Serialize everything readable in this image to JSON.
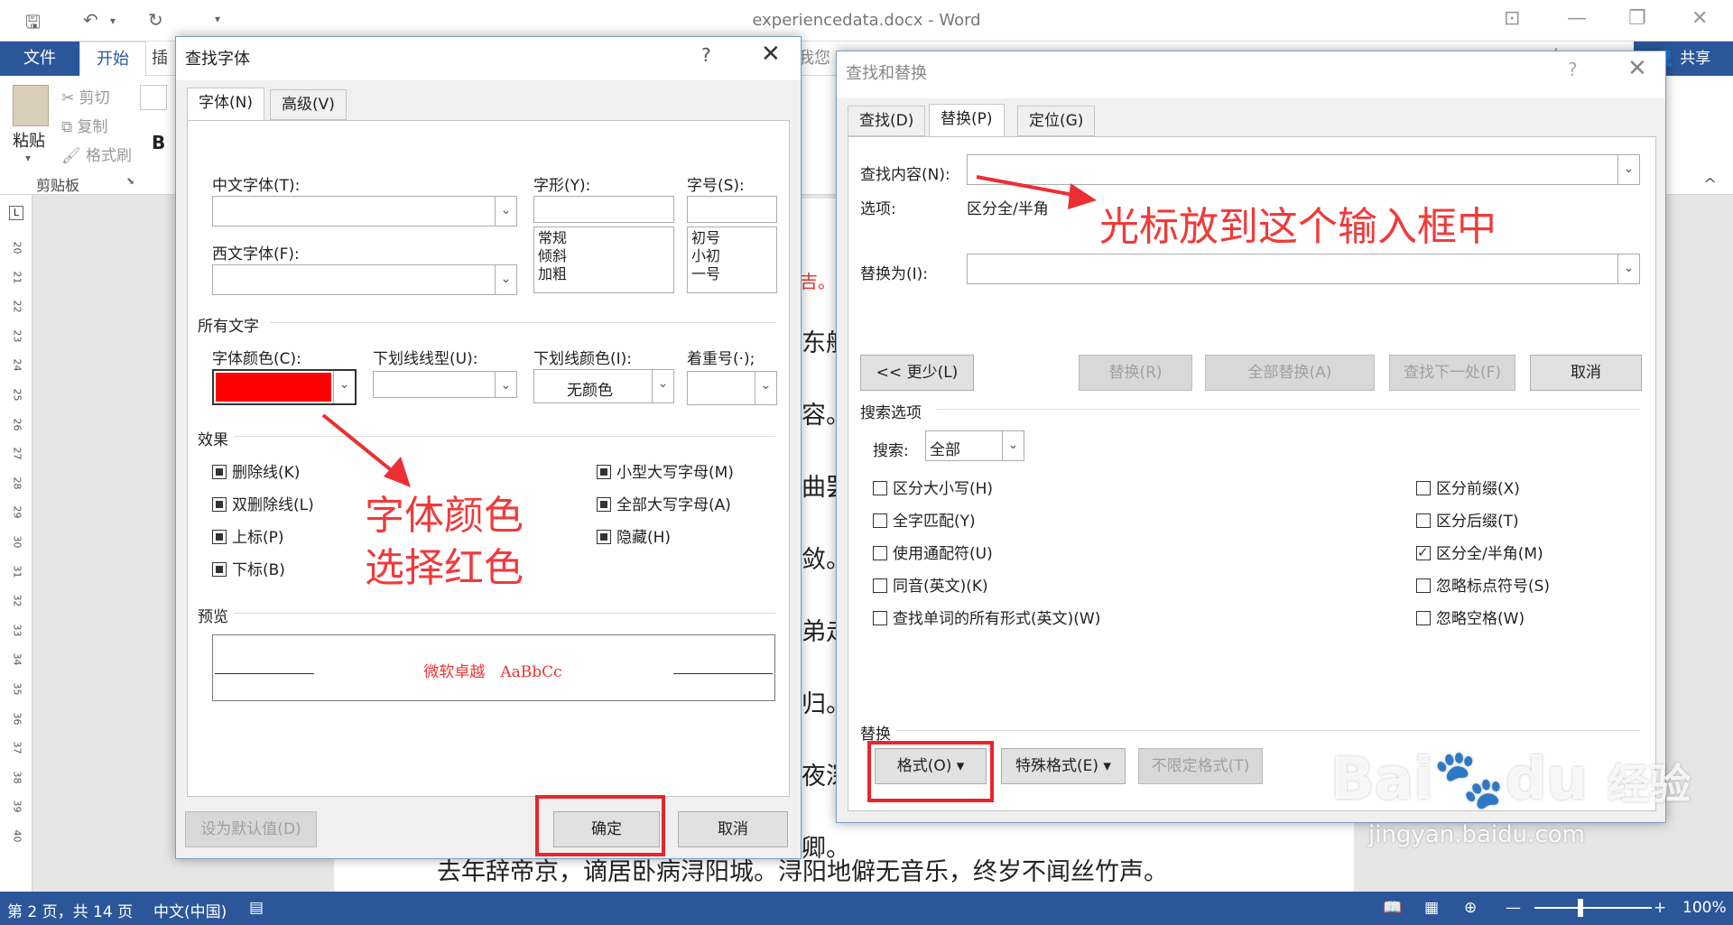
{
  "word": {
    "title": "experiencedata.docx - Word",
    "tabs": {
      "file": "文件",
      "home": "开始",
      "insert_partial": "插",
      "tellme_partial": "我您"
    },
    "share": "共享",
    "clipboard": {
      "paste": "粘贴",
      "cut": "剪切",
      "copy": "复制",
      "format_painter": "格式刷",
      "group": "剪贴板",
      "bold": "B"
    },
    "doc_line": "去年辞帝京，谪居卧病浔阳城。浔阳地僻无音乐，终岁不闻丝竹声。",
    "side_fragments": [
      "东船",
      "容。",
      "曲罢",
      "敛。",
      "弟走",
      "归。",
      "夜深",
      "卿。"
    ],
    "ruler_numbers": [
      "20",
      "21",
      "22",
      "23",
      "24",
      "25",
      "26",
      "27",
      "28",
      "29",
      "30",
      "31",
      "32",
      "33",
      "34",
      "35",
      "36",
      "37",
      "38",
      "39",
      "40"
    ],
    "status": {
      "page": "第 2 页，共 14 页",
      "lang": "中文(中国)",
      "zoom": "100%"
    }
  },
  "font_dialog": {
    "title": "查找字体",
    "help": "?",
    "tabs": [
      "字体(N)",
      "高级(V)"
    ],
    "chinese_font_label": "中文字体(T):",
    "western_font_label": "西文字体(F):",
    "style_label": "字形(Y):",
    "style_options": [
      "常规",
      "倾斜",
      "加粗"
    ],
    "size_label": "字号(S):",
    "size_options": [
      "初号",
      "小初",
      "一号"
    ],
    "all_text_label": "所有文字",
    "font_color_label": "字体颜色(C):",
    "font_color_value": "#ff0000",
    "underline_style_label": "下划线线型(U):",
    "underline_color_label": "下划线颜色(I):",
    "underline_color_value": "无颜色",
    "emphasis_label": "着重号(·);",
    "effects_label": "效果",
    "effects_left": [
      "删除线(K)",
      "双删除线(L)",
      "上标(P)",
      "下标(B)"
    ],
    "effects_right": [
      "小型大写字母(M)",
      "全部大写字母(A)",
      "隐藏(H)"
    ],
    "preview_label": "预览",
    "preview_text": "微软卓越　AaBbCc",
    "set_default": "设为默认值(D)",
    "ok": "确定",
    "cancel": "取消"
  },
  "replace_dialog": {
    "title": "查找和替换",
    "help": "?",
    "tabs": [
      "查找(D)",
      "替换(P)",
      "定位(G)"
    ],
    "find_label": "查找内容(N):",
    "options_label": "选项:",
    "options_value": "区分全/半角",
    "replace_label": "替换为(I):",
    "less_button": "<< 更少(L)",
    "replace_button": "替换(R)",
    "replace_all_button": "全部替换(A)",
    "find_next_button": "查找下一处(F)",
    "cancel_button": "取消",
    "search_options_label": "搜索选项",
    "search_label": "搜索:",
    "search_value": "全部",
    "left_checks": [
      {
        "label": "区分大小写(H)",
        "checked": false
      },
      {
        "label": "全字匹配(Y)",
        "checked": false
      },
      {
        "label": "使用通配符(U)",
        "checked": false
      },
      {
        "label": "同音(英文)(K)",
        "checked": false
      },
      {
        "label": "查找单词的所有形式(英文)(W)",
        "checked": false
      }
    ],
    "right_checks": [
      {
        "label": "区分前缀(X)",
        "checked": false
      },
      {
        "label": "区分后缀(T)",
        "checked": false
      },
      {
        "label": "区分全/半角(M)",
        "checked": true
      },
      {
        "label": "忽略标点符号(S)",
        "checked": false
      },
      {
        "label": "忽略空格(W)",
        "checked": false
      }
    ],
    "replace_section_label": "替换",
    "format_button": "格式(O) ▾",
    "special_button": "特殊格式(E) ▾",
    "no_format_button": "不限定格式(T)"
  },
  "annotations": {
    "cursor_hint": "光标放到这个输入框中",
    "color_hint_1": "字体颜色",
    "color_hint_2": "选择红色"
  },
  "watermark": {
    "brand": "Bai",
    "brand2": "du",
    "jingyan": "经验",
    "url": "jingyan.baidu.com"
  }
}
